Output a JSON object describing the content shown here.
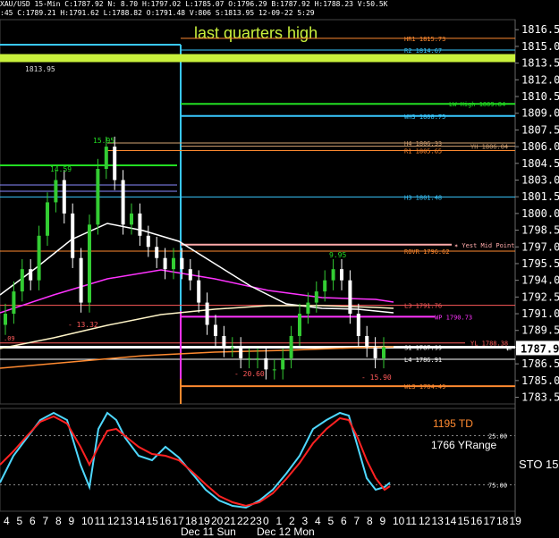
{
  "header": {
    "line1": "XAU/USD 15-Min  C:1787.92  N: 8.70  H:1797.02  L:1785.07  O:1796.29  B:1787.92  H:1788.23  V:50.5K",
    "line2": ":45  C:1789.21  H:1791.62  L:1788.82  O:1791.48  V:806  S:1813.95  12-09-22  5:29"
  },
  "colors": {
    "background": "#000000",
    "accent_line": "#c8f03c",
    "cyan": "#39c8ff",
    "green": "#22dd22",
    "magenta": "#ff33ff",
    "orange": "#ff8a30",
    "red_line": "#ff5a5a",
    "sto_fast": "#4fd8ff",
    "sto_slow": "#ff2222",
    "candle_up": "#33cc33",
    "candle_down": "#ffffff"
  },
  "chart_data": {
    "type": "candlestick",
    "title": "last quarters high",
    "price_axis": {
      "ticks": [
        "1816.50",
        "1815.00",
        "1813.50",
        "1812.00",
        "1810.50",
        "1809.00",
        "1807.50",
        "1806.00",
        "1804.50",
        "1803.00",
        "1801.50",
        "1800.00",
        "1798.50",
        "1797.00",
        "1795.50",
        "1794.00",
        "1792.50",
        "1791.00",
        "1789.50",
        "1788.00",
        "1786.50",
        "1785.00",
        "1783.50"
      ],
      "range": [
        1782.9,
        1817.4
      ],
      "last_price": "1787.92"
    },
    "time_axis": {
      "ticks": [
        "4",
        "5",
        "6",
        "7",
        "8",
        "9",
        "10",
        "11",
        "12",
        "13",
        "14",
        "15",
        "16",
        "17",
        "18",
        "19",
        "20",
        "21",
        "22",
        "23",
        "0",
        "1",
        "2",
        "3",
        "4",
        "5",
        "6",
        "7",
        "8",
        "9",
        "10",
        "11",
        "12",
        "13",
        "14",
        "15",
        "16",
        "17",
        "18",
        "19"
      ],
      "dates": [
        "Dec 11 Sun",
        "Dec 12 Mon"
      ]
    },
    "levels": [
      {
        "label": "last quarters high",
        "price": 1813.95,
        "color": "#c8f03c"
      },
      {
        "label": "HR1 1815.73",
        "price": 1815.73,
        "color": "#ff8a30"
      },
      {
        "label": "R2 1814.67",
        "price": 1814.67,
        "color": "#39c8ff"
      },
      {
        "label": "LW High 1809.84",
        "price": 1809.84,
        "color": "#22dd22"
      },
      {
        "label": "WH3 1808.75",
        "price": 1808.75,
        "color": "#39c8ff"
      },
      {
        "label": "H4 1806.33",
        "price": 1806.33,
        "color": "#d4a373"
      },
      {
        "label": "YH 1806.04",
        "price": 1806.04,
        "color": "#d4a373"
      },
      {
        "label": "R1 1805.65",
        "price": 1805.65,
        "color": "#ff8a30"
      },
      {
        "label": "H3 1801.48",
        "price": 1801.48,
        "color": "#39c8ff"
      },
      {
        "label": "Yest Mid Point",
        "price": 1797.2,
        "color": "#ffaaaa"
      },
      {
        "label": "ROVR 1796.62",
        "price": 1796.62,
        "color": "#ff8a30"
      },
      {
        "label": "L3 1791.76",
        "price": 1791.76,
        "color": "#ff5a5a"
      },
      {
        "label": "WP 1790.73",
        "price": 1790.73,
        "color": "#ff33ff"
      },
      {
        "label": "YL 1788.38",
        "price": 1788.38,
        "color": "#ff5a5a"
      },
      {
        "label": "S1 1787.99",
        "price": 1787.99,
        "color": "#ffffff"
      },
      {
        "label": "L4 1786.91",
        "price": 1786.91,
        "color": "#ffffff"
      },
      {
        "label": "WL3 1784.49",
        "price": 1784.49,
        "color": "#ff8a30"
      }
    ],
    "annotations": [
      "15.95",
      "14.59",
      "- 13.32",
      "9.95",
      "- 20.60",
      "1813.95",
      "- 15.90"
    ],
    "info_labels": {
      "td": "1195 TD",
      "yrange": "1766 YRange"
    },
    "oscillator": {
      "name": "STO",
      "value": "15",
      "levels": [
        "25.00",
        "75.00"
      ]
    },
    "series": [
      {
        "name": "price",
        "close": [
          1791,
          1793,
          1795,
          1794,
          1798,
          1801,
          1803,
          1800,
          1796,
          1792,
          1799,
          1804,
          1806,
          1803,
          1799,
          1800,
          1798,
          1797,
          1796,
          1795,
          1796,
          1795,
          1794,
          1792,
          1790,
          1789,
          1788,
          1788,
          1787,
          1787,
          1787,
          1786,
          1786,
          1787,
          1789,
          1791,
          1792,
          1793,
          1794,
          1795,
          1794,
          1791,
          1789,
          1788,
          1787,
          1788
        ]
      }
    ]
  }
}
